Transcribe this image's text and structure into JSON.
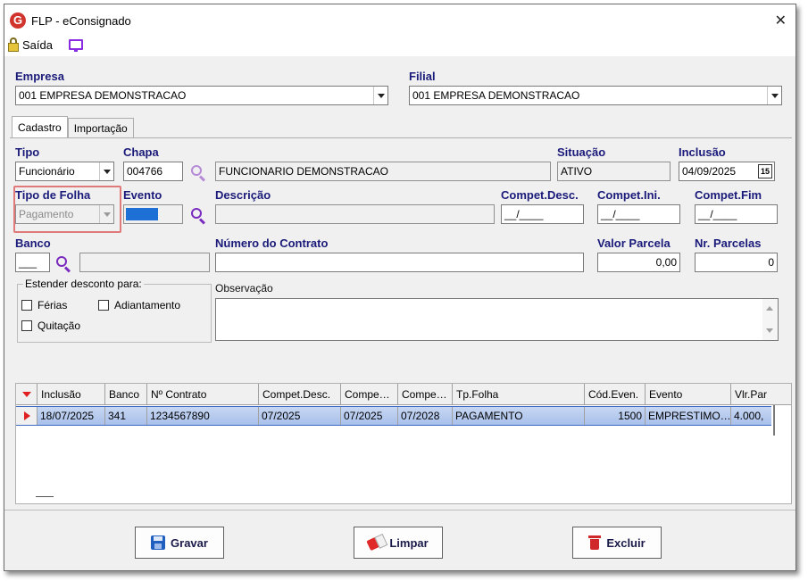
{
  "window": {
    "title": "FLP - eConsignado",
    "close_glyph": "✕"
  },
  "toolbar": {
    "exit_label": "Saída",
    "exit_icon": "lock-icon",
    "monitor_icon": "monitor-icon"
  },
  "header": {
    "empresa_label": "Empresa",
    "empresa_value": "001 EMPRESA DEMONSTRACAO",
    "filial_label": "Filial",
    "filial_value": "001 EMPRESA DEMONSTRACAO"
  },
  "tabs": [
    {
      "label": "Cadastro",
      "active": true
    },
    {
      "label": "Importação",
      "active": false
    }
  ],
  "form": {
    "tipo_label": "Tipo",
    "tipo_value": "Funcionário",
    "chapa_label": "Chapa",
    "chapa_value": "004766",
    "nome_value": "FUNCIONARIO DEMONSTRACAO",
    "situacao_label": "Situação",
    "situacao_value": "ATIVO",
    "inclusao_label": "Inclusão",
    "inclusao_value": "04/09/2025",
    "calendar_glyph": "15",
    "tipo_folha_label": "Tipo de Folha",
    "tipo_folha_value": "Pagamento",
    "evento_label": "Evento",
    "descricao_label": "Descrição",
    "compet_desc_label": "Compet.Desc.",
    "compet_desc_value": "__/____",
    "compet_ini_label": "Compet.Ini.",
    "compet_ini_value": "__/____",
    "compet_fim_label": "Compet.Fim",
    "compet_fim_value": "__/____",
    "banco_label": "Banco",
    "banco_value": "___",
    "numero_contrato_label": "Número do Contrato",
    "valor_parcela_label": "Valor Parcela",
    "valor_parcela_value": "0,00",
    "nr_parcelas_label": "Nr. Parcelas",
    "nr_parcelas_value": "0",
    "estender_label": "Estender desconto para:",
    "ferias_label": "Férias",
    "adiantamento_label": "Adiantamento",
    "quitacao_label": "Quitação",
    "observacao_label": "Observação"
  },
  "grid": {
    "columns": [
      "Inclusão",
      "Banco",
      "Nº Contrato",
      "Compet.Desc.",
      "Compe…",
      "Compe…",
      "Tp.Folha",
      "Cód.Even.",
      "Evento",
      "Vlr.Par"
    ],
    "rows": [
      [
        "18/07/2025",
        "341",
        "1234567890",
        "07/2025",
        "07/2025",
        "07/2028",
        "PAGAMENTO",
        "1500",
        "EMPRESTIMO…",
        "4.000,"
      ]
    ]
  },
  "buttons": {
    "gravar": "Gravar",
    "limpar": "Limpar",
    "excluir": "Excluir"
  },
  "colors": {
    "label_blue": "#1a1a7a",
    "selected_row": "#b7cbef",
    "highlight_border": "#e0797a",
    "evento_fill": "#1e6fd6"
  }
}
